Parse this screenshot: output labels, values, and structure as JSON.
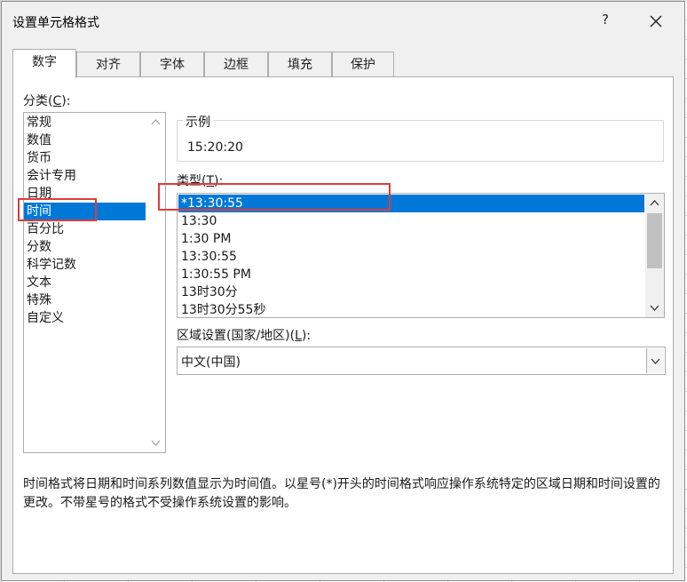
{
  "dialog": {
    "title": "设置单元格格式",
    "help_label": "?"
  },
  "tabs": [
    {
      "label": "数字",
      "active": true
    },
    {
      "label": "对齐",
      "active": false
    },
    {
      "label": "字体",
      "active": false
    },
    {
      "label": "边框",
      "active": false
    },
    {
      "label": "填充",
      "active": false
    },
    {
      "label": "保护",
      "active": false
    }
  ],
  "category": {
    "label_prefix": "分类(",
    "label_key": "C",
    "label_suffix": "):",
    "items": [
      "常规",
      "数值",
      "货币",
      "会计专用",
      "日期",
      "时间",
      "百分比",
      "分数",
      "科学记数",
      "文本",
      "特殊",
      "自定义"
    ],
    "selected": "时间"
  },
  "sample": {
    "legend": "示例",
    "value": "15:20:20"
  },
  "type": {
    "label_prefix": "类型(",
    "label_key": "T",
    "label_suffix": "):",
    "items": [
      "*13:30:55",
      "13:30",
      "1:30 PM",
      "13:30:55",
      "1:30:55 PM",
      "13时30分",
      "13时30分55秒"
    ],
    "selected": "*13:30:55"
  },
  "locale": {
    "label_prefix": "区域设置(国家/地区)(",
    "label_key": "L",
    "label_suffix": "):",
    "value": "中文(中国)"
  },
  "description": "时间格式将日期和时间系列数值显示为时间值。以星号(*)开头的时间格式响应操作系统特定的区域日期和时间设置的更改。不带星号的格式不受操作系统设置的影响。",
  "colors": {
    "selection": "#0078d7",
    "highlight": "#e03b3b",
    "dialog_bg": "#f0f0f0"
  },
  "icons": {
    "close": "close-icon",
    "scroll_up": "chevron-up-icon",
    "scroll_down": "chevron-down-icon",
    "dropdown": "chevron-down-icon"
  }
}
